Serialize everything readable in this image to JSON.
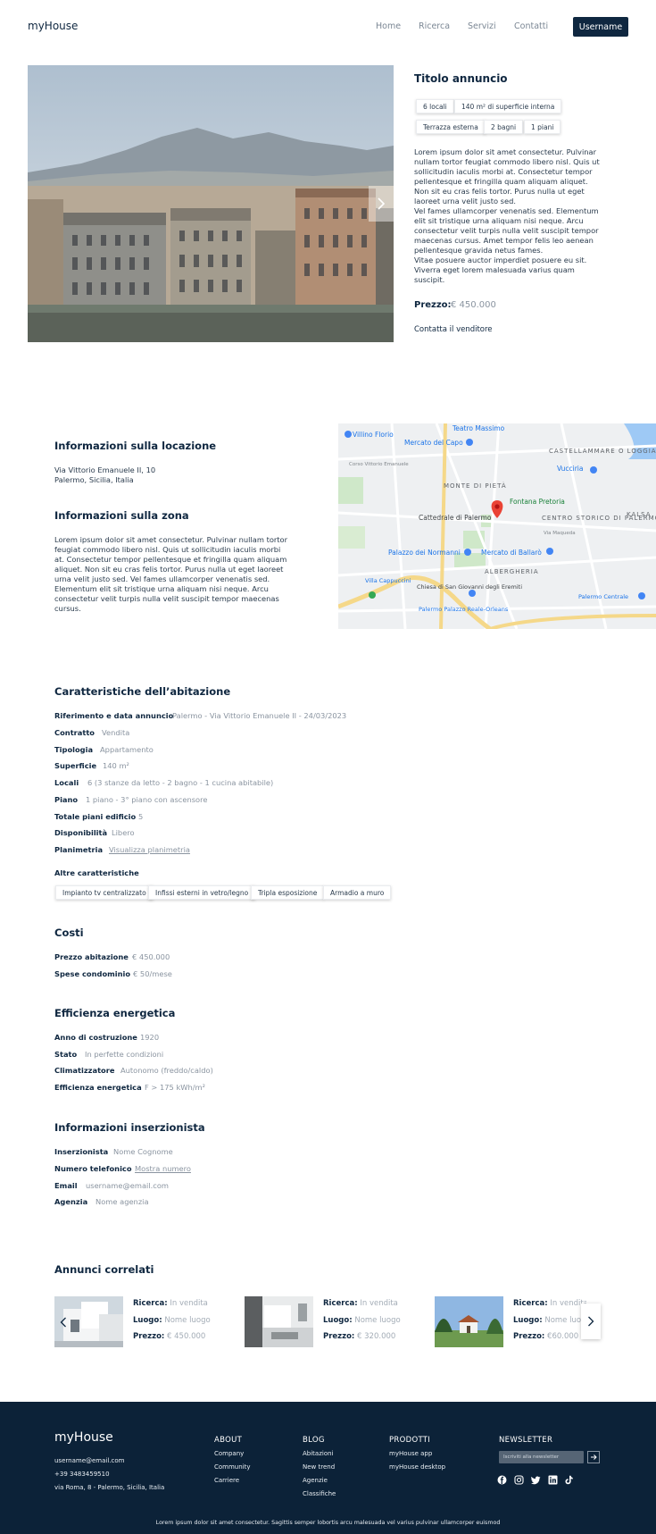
{
  "header": {
    "logo": "myHouse",
    "nav": [
      "Home",
      "Ricerca",
      "Servizi",
      "Contatti"
    ],
    "user_button": "Username"
  },
  "listing": {
    "title": "Titolo annuncio",
    "tags": [
      "6 locali",
      "140 m² di superficie interna",
      "Terrazza esterna",
      "2 bagni",
      "1 piani"
    ],
    "description": "Lorem ipsum dolor sit amet consectetur. Pulvinar nullam tortor feugiat commodo libero nisl. Quis ut sollicitudin iaculis morbi at. Consectetur tempor pellentesque et fringilla quam aliquam aliquet. Non sit eu cras felis tortor. Purus nulla ut eget laoreet urna velit justo sed.\nVel fames ullamcorper venenatis sed. Elementum elit sit tristique urna aliquam nisi neque. Arcu consectetur velit turpis nulla velit suscipit tempor maecenas cursus. Amet tempor felis leo aenean pellentesque gravida netus fames.\nVitae posuere auctor imperdiet posuere eu sit. Viverra eget lorem malesuada varius quam suscipit.",
    "price_label": "Prezzo:",
    "price_value": "€ 450.000",
    "contact_link": "Contatta il venditore"
  },
  "location": {
    "title": "Informazioni sulla locazione",
    "address_line1": "Via Vittorio Emanuele II, 10",
    "address_line2": "Palermo, Sicilia, Italia",
    "zone_title": "Informazioni sulla zona",
    "zone_text": "Lorem ipsum dolor sit amet consectetur. Pulvinar nullam tortor feugiat commodo libero nisl. Quis ut sollicitudin iaculis morbi at. Consectetur tempor pellentesque et fringilla quam aliquam aliquet. Non sit eu cras felis tortor. Purus nulla ut eget laoreet urna velit justo sed. Vel fames ullamcorper venenatis sed. Elementum elit sit tristique urna aliquam nisi neque. Arcu consectetur velit turpis nulla velit suscipit tempor maecenas cursus."
  },
  "map": {
    "labels": [
      "Teatro Massimo",
      "Villino Florio",
      "Mercato del Capo",
      "CASTELLAMMARE O LOGGIA",
      "Vucciria",
      "MONTE DI PIETÀ",
      "Fontana Pretoria",
      "Cattedrale di Palermo",
      "CENTRO STORICO DI PALERMO",
      "KALSA",
      "Palazzo dei Normanni",
      "Mercato di Ballarò",
      "ALBERGHERIA",
      "Villa Cappuccini",
      "Chiesa di San Giovanni degli Eremiti",
      "Palermo Palazzo Reale-Orleans",
      "Palermo Centrale",
      "Via Maqueda",
      "Corso Vittorio Emanuele"
    ]
  },
  "features": {
    "title": "Caratteristiche dell’abitazione",
    "rows": [
      {
        "label": "Riferimento e data annuncio",
        "value": "Palermo - Via Vittorio Emanuele II - 24/03/2023"
      },
      {
        "label": "Contratto",
        "value": "Vendita"
      },
      {
        "label": "Tipologia",
        "value": "Appartamento"
      },
      {
        "label": "Superficie",
        "value": "140 m²"
      },
      {
        "label": "Locali",
        "value": "6 (3 stanze da letto - 2 bagno - 1 cucina abitabile)"
      },
      {
        "label": "Piano",
        "value": "1 piano - 3° piano con ascensore"
      },
      {
        "label": "Totale piani edificio",
        "value": "5"
      },
      {
        "label": "Disponibilità",
        "value": "Libero"
      },
      {
        "label": "Planimetria",
        "value": "Visualizza planimetria"
      }
    ],
    "other_title": "Altre caratteristiche",
    "other_tags": [
      "Impianto tv centralizzato",
      "Infissi esterni in vetro/legno",
      "Tripla esposizione",
      "Armadio a muro"
    ]
  },
  "costs": {
    "title": "Costi",
    "rows": [
      {
        "label": "Prezzo abitazione",
        "value": "€ 450.000"
      },
      {
        "label": "Spese condominio",
        "value": "€ 50/mese"
      }
    ]
  },
  "energy": {
    "title": "Efficienza energetica",
    "rows": [
      {
        "label": "Anno di costruzione",
        "value": "1920"
      },
      {
        "label": "Stato",
        "value": "In perfette condizioni"
      },
      {
        "label": "Climatizzatore",
        "value": "Autonomo (freddo/caldo)"
      },
      {
        "label": "Efficienza energetica",
        "value": "F > 175 kWh/m²"
      }
    ]
  },
  "advertiser": {
    "title": "Informazioni inserzionista",
    "rows": [
      {
        "label": "Inserzionista",
        "value": "Nome Cognome"
      },
      {
        "label": "Numero telefonico",
        "value": "Mostra numero"
      },
      {
        "label": "Email",
        "value": "username@email.com"
      },
      {
        "label": "Agenzia",
        "value": "Nome agenzia"
      }
    ]
  },
  "related": {
    "title": "Annunci correlati",
    "labels": {
      "search": "Ricerca:",
      "place": "Luogo:",
      "price": "Prezzo:"
    },
    "items": [
      {
        "search": "In vendita",
        "place": "Nome luogo",
        "price": "€ 450.000"
      },
      {
        "search": "In vendita",
        "place": "Nome luogo",
        "price": "€ 320.000"
      },
      {
        "search": "In vendita",
        "place": "Nome luogo",
        "price": "€60.000"
      }
    ]
  },
  "footer": {
    "logo": "myHouse",
    "email": "username@email.com",
    "phone": "+39 3483459510",
    "address": "via Roma, 8 - Palermo, Sicilia, Italia",
    "columns": [
      {
        "title": "ABOUT",
        "items": [
          "Company",
          "Community",
          "Carriere"
        ]
      },
      {
        "title": "BLOG",
        "items": [
          "Abitazioni",
          "New trend",
          "Agenzie",
          "Classifiche"
        ]
      },
      {
        "title": "PRODOTTI",
        "items": [
          "myHouse app",
          "myHouse desktop"
        ]
      }
    ],
    "newsletter_title": "NEWSLETTER",
    "newsletter_placeholder": "Iscriviti alla newsletter",
    "socials": [
      "facebook-icon",
      "instagram-icon",
      "twitter-icon",
      "linkedin-icon",
      "tiktok-icon"
    ],
    "bottom_text": "Lorem ipsum dolor sit amet consectetur. Sagittis semper lobortis arcu malesuada vel varius pulvinar ullamcorper euismod"
  },
  "colors": {
    "primary": "#0f2740",
    "footer": "#0c2238",
    "muted": "#8a94a0"
  }
}
